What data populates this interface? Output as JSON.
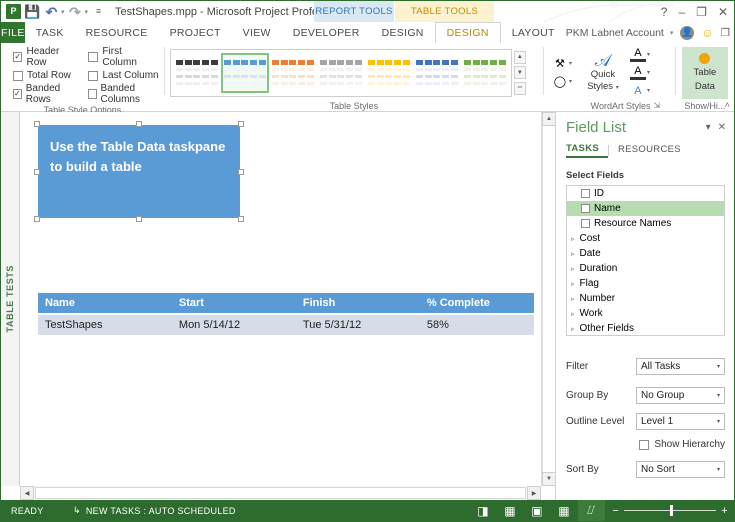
{
  "titlebar": {
    "app_logo": "project-logo",
    "doc_title": "TestShapes.mpp - Microsoft Project Professio...",
    "qat": [
      {
        "name": "save",
        "glyph": "▤"
      },
      {
        "name": "undo",
        "glyph": "↶"
      },
      {
        "name": "redo",
        "glyph": "↷"
      },
      {
        "name": "customize-qat",
        "glyph": "☷"
      }
    ],
    "contextual": [
      {
        "name": "report-tools",
        "label": "REPORT TOOLS",
        "color": "#2e75b6"
      },
      {
        "name": "table-tools",
        "label": "TABLE TOOLS",
        "color": "#bf9000"
      }
    ],
    "window_buttons": {
      "help": "?",
      "minimize": "–",
      "restore": "❐",
      "close": "✕"
    }
  },
  "tabs": {
    "file": "FILE",
    "items": [
      {
        "label": "TASK",
        "active": false
      },
      {
        "label": "RESOURCE",
        "active": false
      },
      {
        "label": "PROJECT",
        "active": false
      },
      {
        "label": "VIEW",
        "active": false
      },
      {
        "label": "DEVELOPER",
        "active": false
      },
      {
        "label": "DESIGN",
        "active": false
      },
      {
        "label": "DESIGN",
        "active": true
      },
      {
        "label": "LAYOUT",
        "active": false
      }
    ],
    "account_name": "PKM Labnet Account",
    "account_caret": "▾",
    "smiley": "☺",
    "restore_window": "❐",
    "close_window": "✕"
  },
  "ribbon": {
    "table_style_options": {
      "group_label": "Table Style Options",
      "checkboxes": [
        {
          "label": "Header Row",
          "checked": true
        },
        {
          "label": "First Column",
          "checked": false
        },
        {
          "label": "Total Row",
          "checked": false
        },
        {
          "label": "Last Column",
          "checked": false
        },
        {
          "label": "Banded Rows",
          "checked": true
        },
        {
          "label": "Banded Columns",
          "checked": false
        }
      ]
    },
    "table_styles": {
      "group_label": "Table Styles",
      "swatches": [
        {
          "name": "style-dark",
          "header": "#3b3b3b",
          "band_a": "#d9d9d9",
          "band_b": "#f0f0f0",
          "selected": false
        },
        {
          "name": "style-blue",
          "header": "#5b9bd5",
          "band_a": "#d6e4f2",
          "band_b": "#eef4fb",
          "selected": true
        },
        {
          "name": "style-orange",
          "header": "#ed7d31",
          "band_a": "#fbddcc",
          "band_b": "#fdeee5",
          "selected": false
        },
        {
          "name": "style-gray",
          "header": "#a5a5a5",
          "band_a": "#e2e2e2",
          "band_b": "#f2f2f2",
          "selected": false
        },
        {
          "name": "style-gold",
          "header": "#ffc000",
          "band_a": "#ffe9b3",
          "band_b": "#fff5dd",
          "selected": false
        },
        {
          "name": "style-darkblue",
          "header": "#4472c4",
          "band_a": "#d3dcef",
          "band_b": "#eaeff8",
          "selected": false
        },
        {
          "name": "style-green",
          "header": "#70ad47",
          "band_a": "#dce9d3",
          "band_b": "#eef4e9",
          "selected": false
        }
      ],
      "scroll_up": "▲",
      "scroll_down": "▼",
      "more": "▾"
    },
    "wordart_styles": {
      "group_label": "WordArt Styles",
      "quick_styles_label": "Quick\nStyles",
      "quick_styles_line1": "Quick",
      "quick_styles_line2": "Styles",
      "buttons": [
        {
          "name": "text-fill",
          "glyph": "A"
        },
        {
          "name": "text-outline",
          "glyph": "A"
        },
        {
          "name": "text-effects",
          "glyph": "A"
        }
      ],
      "dialog_launcher": "⤵"
    },
    "shape_styles": {
      "fill_icon": "shape-fill",
      "effects_icon": "shape-effects"
    },
    "show_hide": {
      "group_label": "Show/Hi...",
      "table_data_line1": "Table",
      "table_data_line2": "Data"
    },
    "collapse_ribbon": "˄"
  },
  "vertical_tab": {
    "label": "TABLE TESTS"
  },
  "canvas": {
    "textbox": {
      "text": "Use the Table Data taskpane to build a table",
      "fill": "#5b9bd5",
      "text_color": "#ffffff"
    },
    "table": {
      "headers": [
        "Name",
        "Start",
        "Finish",
        "% Complete"
      ],
      "rows": [
        [
          "TestShapes",
          "Mon 5/14/12",
          "Tue 5/31/12",
          "58%"
        ]
      ],
      "header_bg": "#5b9bd5",
      "row_bg": "#d6dce8"
    }
  },
  "pane": {
    "title": "Field List",
    "collapse_caret": "▾",
    "close": "✕",
    "tabs": [
      {
        "label": "TASKS",
        "active": true
      },
      {
        "label": "RESOURCES",
        "active": false
      }
    ],
    "select_fields_label": "Select Fields",
    "fields": [
      {
        "label": "ID",
        "type": "checkbox",
        "checked": false,
        "selected": false
      },
      {
        "label": "Name",
        "type": "checkbox",
        "checked": false,
        "selected": true
      },
      {
        "label": "Resource Names",
        "type": "checkbox",
        "checked": false,
        "selected": false
      },
      {
        "label": "Cost",
        "type": "group"
      },
      {
        "label": "Date",
        "type": "group"
      },
      {
        "label": "Duration",
        "type": "group"
      },
      {
        "label": "Flag",
        "type": "group"
      },
      {
        "label": "Number",
        "type": "group"
      },
      {
        "label": "Work",
        "type": "group"
      },
      {
        "label": "Other Fields",
        "type": "group"
      }
    ],
    "group_arrow": "▹",
    "form": {
      "filter_label": "Filter",
      "filter_value": "All Tasks",
      "group_by_label": "Group By",
      "group_by_value": "No Group",
      "outline_level_label": "Outline Level",
      "outline_level_value": "Level 1",
      "show_hierarchy_label": "Show Hierarchy",
      "show_hierarchy_checked": false,
      "sort_by_label": "Sort By",
      "sort_by_value": "No Sort",
      "caret": "▾"
    }
  },
  "statusbar": {
    "ready": "READY",
    "new_tasks": "NEW TASKS : AUTO SCHEDULED",
    "new_tasks_icon": "↳",
    "views": [
      {
        "name": "gantt-chart-view",
        "glyph": "◨",
        "active": false
      },
      {
        "name": "task-usage-view",
        "glyph": "▦",
        "active": false
      },
      {
        "name": "team-planner-view",
        "glyph": "▣",
        "active": false
      },
      {
        "name": "resource-sheet-view",
        "glyph": "▦",
        "active": false
      },
      {
        "name": "reports-view",
        "glyph": "⌰",
        "active": true
      }
    ],
    "zoom_out": "−",
    "zoom_in": "+",
    "background": "#2e6b2e"
  }
}
